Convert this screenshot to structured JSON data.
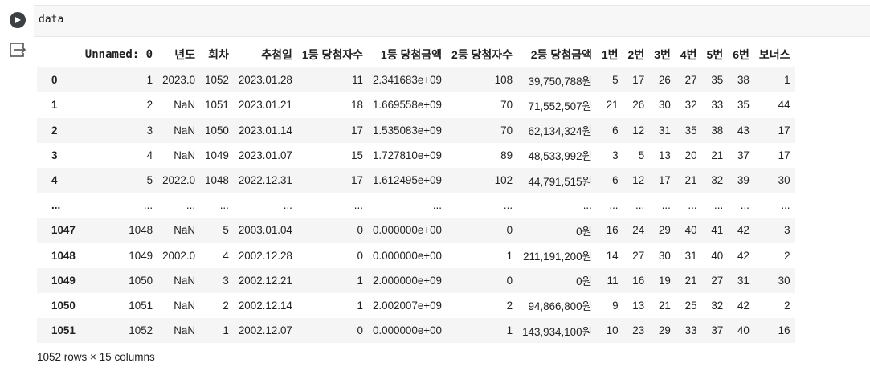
{
  "code": {
    "text": "data"
  },
  "table": {
    "columns": [
      "",
      "Unnamed: 0",
      "년도",
      "회차",
      "추첨일",
      "1등 당첨자수",
      "1등 당첨금액",
      "2등 당첨자수",
      "2등 당첨금액",
      "1번",
      "2번",
      "3번",
      "4번",
      "5번",
      "6번",
      "보너스"
    ],
    "rows": [
      [
        "0",
        "1",
        "2023.0",
        "1052",
        "2023.01.28",
        "11",
        "2.341683e+09",
        "108",
        "39,750,788원",
        "5",
        "17",
        "26",
        "27",
        "35",
        "38",
        "1"
      ],
      [
        "1",
        "2",
        "NaN",
        "1051",
        "2023.01.21",
        "18",
        "1.669558e+09",
        "70",
        "71,552,507원",
        "21",
        "26",
        "30",
        "32",
        "33",
        "35",
        "44"
      ],
      [
        "2",
        "3",
        "NaN",
        "1050",
        "2023.01.14",
        "17",
        "1.535083e+09",
        "70",
        "62,134,324원",
        "6",
        "12",
        "31",
        "35",
        "38",
        "43",
        "17"
      ],
      [
        "3",
        "4",
        "NaN",
        "1049",
        "2023.01.07",
        "15",
        "1.727810e+09",
        "89",
        "48,533,992원",
        "3",
        "5",
        "13",
        "20",
        "21",
        "37",
        "17"
      ],
      [
        "4",
        "5",
        "2022.0",
        "1048",
        "2022.12.31",
        "17",
        "1.612495e+09",
        "102",
        "44,791,515원",
        "6",
        "12",
        "17",
        "21",
        "32",
        "39",
        "30"
      ],
      [
        "...",
        "...",
        "...",
        "...",
        "...",
        "...",
        "...",
        "...",
        "...",
        "...",
        "...",
        "...",
        "...",
        "...",
        "...",
        "..."
      ],
      [
        "1047",
        "1048",
        "NaN",
        "5",
        "2003.01.04",
        "0",
        "0.000000e+00",
        "0",
        "0원",
        "16",
        "24",
        "29",
        "40",
        "41",
        "42",
        "3"
      ],
      [
        "1048",
        "1049",
        "2002.0",
        "4",
        "2002.12.28",
        "0",
        "0.000000e+00",
        "1",
        "211,191,200원",
        "14",
        "27",
        "30",
        "31",
        "40",
        "42",
        "2"
      ],
      [
        "1049",
        "1050",
        "NaN",
        "3",
        "2002.12.21",
        "1",
        "2.000000e+09",
        "0",
        "0원",
        "11",
        "16",
        "19",
        "21",
        "27",
        "31",
        "30"
      ],
      [
        "1050",
        "1051",
        "NaN",
        "2",
        "2002.12.14",
        "1",
        "2.002007e+09",
        "2",
        "94,866,800원",
        "9",
        "13",
        "21",
        "25",
        "32",
        "42",
        "2"
      ],
      [
        "1051",
        "1052",
        "NaN",
        "1",
        "2002.12.07",
        "0",
        "0.000000e+00",
        "1",
        "143,934,100원",
        "10",
        "23",
        "29",
        "33",
        "37",
        "40",
        "16"
      ]
    ],
    "shape": "1052 rows × 15 columns"
  }
}
